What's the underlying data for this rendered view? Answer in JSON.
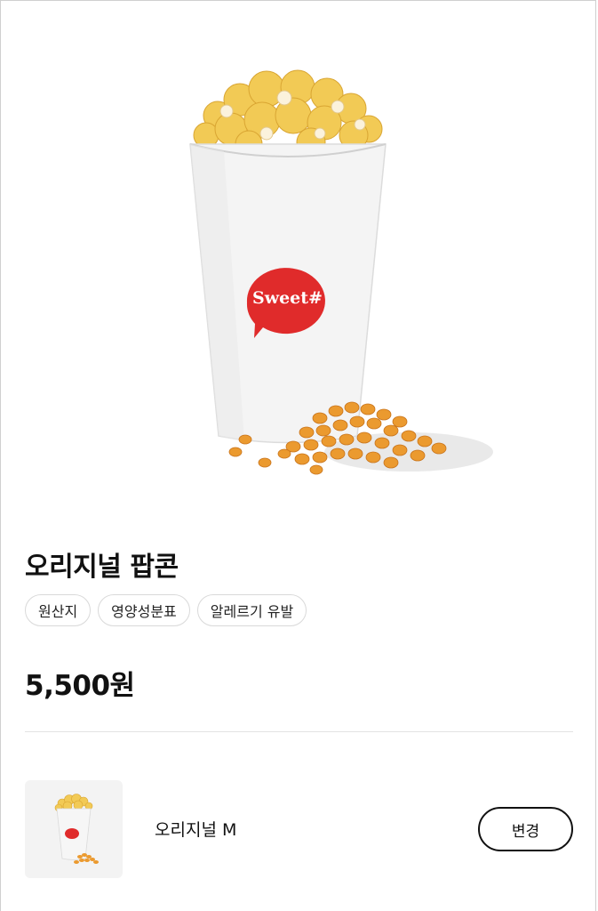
{
  "product": {
    "name": "오리지널 팝콘",
    "cup_logo": "Sweet#",
    "price": "5,500원"
  },
  "info_chips": [
    {
      "label": "원산지"
    },
    {
      "label": "영양성분표"
    },
    {
      "label": "알레르기 유발"
    }
  ],
  "option": {
    "label": "오리지널 M",
    "change_label": "변경"
  },
  "colors": {
    "logo_red": "#e02b2b",
    "popcorn": "#f0c24a",
    "kernel": "#e8922a"
  }
}
